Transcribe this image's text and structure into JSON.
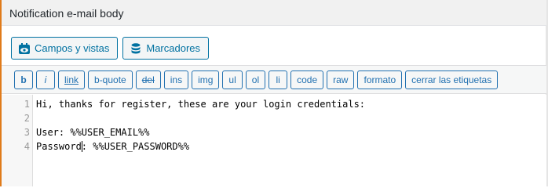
{
  "panel": {
    "title": "Notification e-mail body"
  },
  "media_buttons": [
    {
      "label": "Campos y vistas",
      "icon": "fields-views-icon"
    },
    {
      "label": "Marcadores",
      "icon": "database-icon"
    }
  ],
  "quicktags": [
    {
      "label": "b",
      "style": "b"
    },
    {
      "label": "i",
      "style": "i"
    },
    {
      "label": "link",
      "style": "link"
    },
    {
      "label": "b-quote",
      "style": ""
    },
    {
      "label": "del",
      "style": "del"
    },
    {
      "label": "ins",
      "style": ""
    },
    {
      "label": "img",
      "style": ""
    },
    {
      "label": "ul",
      "style": ""
    },
    {
      "label": "ol",
      "style": ""
    },
    {
      "label": "li",
      "style": ""
    },
    {
      "label": "code",
      "style": ""
    },
    {
      "label": "raw",
      "style": ""
    },
    {
      "label": "formato",
      "style": ""
    },
    {
      "label": "cerrar las etiquetas",
      "style": ""
    }
  ],
  "editor": {
    "lines": [
      {
        "num": "1",
        "text": "Hi, thanks for register, these are your login credentials:"
      },
      {
        "num": "2",
        "text": ""
      },
      {
        "num": "3",
        "text": "User: %%USER_EMAIL%%"
      },
      {
        "num": "4",
        "text": "Password: %%USER_PASSWORD%%"
      }
    ]
  },
  "colors": {
    "accent": "#e07b1a",
    "button": "#2271b1"
  }
}
